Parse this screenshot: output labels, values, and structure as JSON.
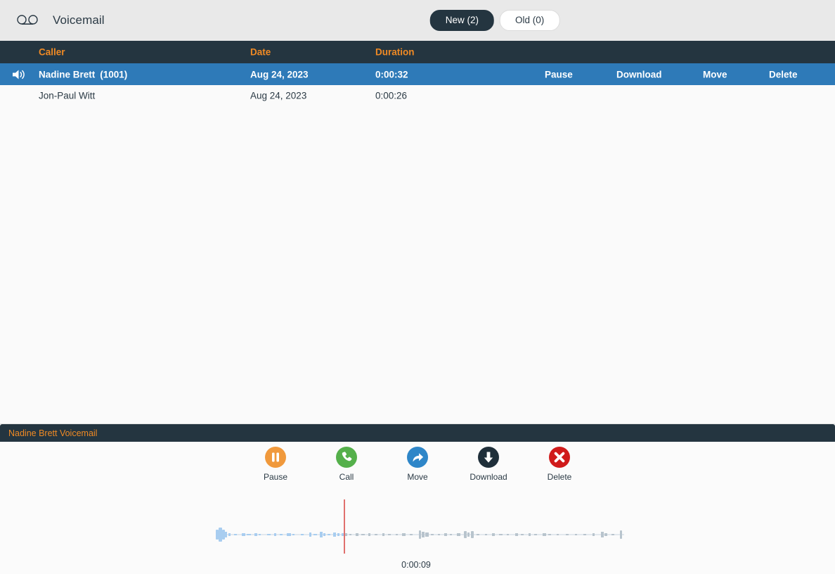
{
  "header": {
    "icon": "tape-icon",
    "title": "Voicemail",
    "tabs": [
      {
        "label": "New (2)",
        "active": true
      },
      {
        "label": "Old (0)",
        "active": false
      }
    ]
  },
  "table": {
    "columns": [
      "Caller",
      "Date",
      "Duration"
    ],
    "rows": [
      {
        "icon": "speaker-icon",
        "caller": "Nadine Brett",
        "extension": "(1001)",
        "date": "Aug 24, 2023",
        "duration": "0:00:32",
        "selected": true,
        "actions": [
          "Pause",
          "Download",
          "Move",
          "Delete"
        ]
      },
      {
        "icon": "",
        "caller": "Jon-Paul Witt",
        "extension": "",
        "date": "Aug 24, 2023",
        "duration": "0:00:26",
        "selected": false,
        "actions": []
      }
    ]
  },
  "player": {
    "title": "Nadine Brett Voicemail",
    "controls": [
      {
        "label": "Pause",
        "icon": "pause-icon",
        "color": "#f0993c"
      },
      {
        "label": "Call",
        "icon": "phone-icon",
        "color": "#55b04b"
      },
      {
        "label": "Move",
        "icon": "forward-icon",
        "color": "#2e86c8"
      },
      {
        "label": "Download",
        "icon": "download-icon",
        "color": "#1f2f3a"
      },
      {
        "label": "Delete",
        "icon": "close-icon",
        "color": "#d01b1b"
      }
    ],
    "current_time": "0:00:09",
    "playhead_color": "#e0706e",
    "waveform_played_color": "#a8cdf0",
    "waveform_remaining_color": "#b8c4cd"
  },
  "colors": {
    "header_bg": "#e9e9e9",
    "dark_bar": "#243540",
    "accent_orange": "#f08a24",
    "selected_row": "#2e7ab8",
    "page_bg": "#fafafa"
  }
}
